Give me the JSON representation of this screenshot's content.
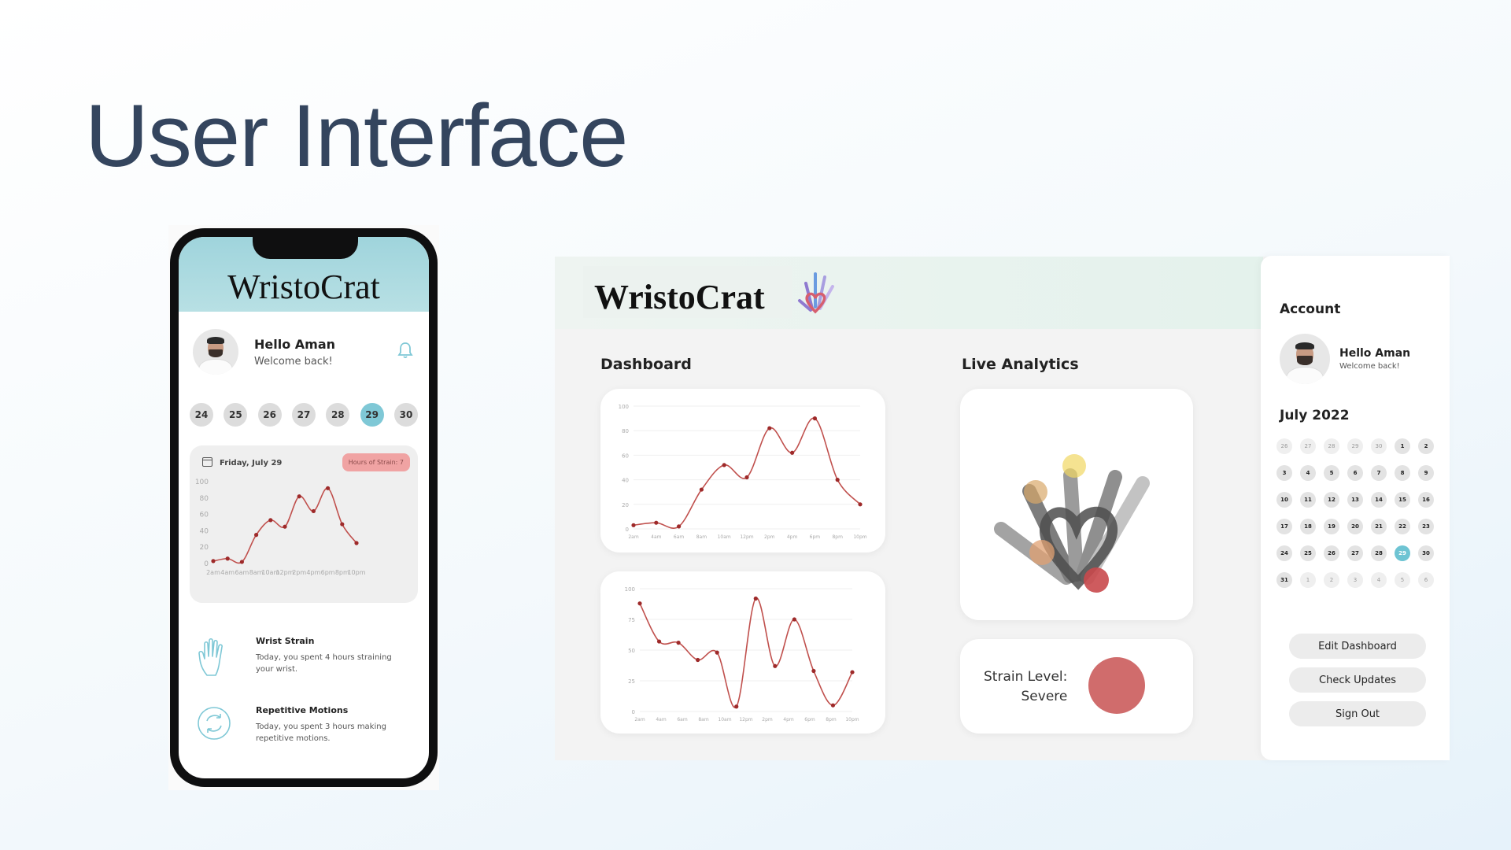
{
  "slide": {
    "title": "User Interface"
  },
  "phone": {
    "brand": "WristoCrat",
    "greeting": "Hello Aman",
    "welcome": "Welcome back!",
    "dates": [
      {
        "day": "24",
        "active": false
      },
      {
        "day": "25",
        "active": false
      },
      {
        "day": "26",
        "active": false
      },
      {
        "day": "27",
        "active": false
      },
      {
        "day": "28",
        "active": false
      },
      {
        "day": "29",
        "active": true
      },
      {
        "day": "30",
        "active": false
      }
    ],
    "card": {
      "date_label": "Friday, July 29",
      "badge": "Hours of Strain: 7"
    },
    "metrics": [
      {
        "title": "Wrist Strain",
        "text": "Today, you spent 4 hours straining your wrist."
      },
      {
        "title": "Repetitive Motions",
        "text": "Today, you spent 3 hours making repetitive motions."
      }
    ]
  },
  "desktop": {
    "brand": "WristoCrat",
    "dashboard_label": "Dashboard",
    "live_label": "Live Analytics",
    "strain_level_label": "Strain Level:",
    "strain_level_value": "Severe",
    "strain_color": "#d06c6c"
  },
  "sidebar": {
    "account_label": "Account",
    "greeting": "Hello Aman",
    "welcome": "Welcome back!",
    "month": "July 2022",
    "calendar": [
      {
        "d": "26",
        "m": true
      },
      {
        "d": "27",
        "m": true
      },
      {
        "d": "28",
        "m": true
      },
      {
        "d": "29",
        "m": true
      },
      {
        "d": "30",
        "m": true
      },
      {
        "d": "1"
      },
      {
        "d": "2"
      },
      {
        "d": "3"
      },
      {
        "d": "4"
      },
      {
        "d": "5"
      },
      {
        "d": "6"
      },
      {
        "d": "7"
      },
      {
        "d": "8"
      },
      {
        "d": "9"
      },
      {
        "d": "10"
      },
      {
        "d": "11"
      },
      {
        "d": "12"
      },
      {
        "d": "13"
      },
      {
        "d": "14"
      },
      {
        "d": "15"
      },
      {
        "d": "16"
      },
      {
        "d": "17"
      },
      {
        "d": "18"
      },
      {
        "d": "19"
      },
      {
        "d": "20"
      },
      {
        "d": "21"
      },
      {
        "d": "22"
      },
      {
        "d": "23"
      },
      {
        "d": "24"
      },
      {
        "d": "25"
      },
      {
        "d": "26"
      },
      {
        "d": "27"
      },
      {
        "d": "28"
      },
      {
        "d": "29",
        "a": true
      },
      {
        "d": "30"
      },
      {
        "d": "31"
      },
      {
        "d": "1",
        "m": true
      },
      {
        "d": "2",
        "m": true
      },
      {
        "d": "3",
        "m": true
      },
      {
        "d": "4",
        "m": true
      },
      {
        "d": "5",
        "m": true
      },
      {
        "d": "6",
        "m": true
      }
    ],
    "buttons": [
      "Edit Dashboard",
      "Check Updates",
      "Sign Out"
    ]
  },
  "chart_data": [
    {
      "type": "line",
      "x": [
        "2am",
        "4am",
        "6am",
        "8am",
        "10am",
        "12pm",
        "2pm",
        "4pm",
        "6pm",
        "8pm",
        "10pm"
      ],
      "series": [
        {
          "values": [
            3,
            6,
            2,
            35,
            53,
            45,
            82,
            64,
            92,
            48,
            25
          ]
        }
      ],
      "ylim": [
        0,
        100
      ],
      "yticks": [
        0,
        20,
        40,
        60,
        80,
        100
      ],
      "color": "#c0504d"
    },
    {
      "type": "line",
      "x": [
        "2am",
        "4am",
        "6am",
        "8am",
        "10am",
        "12pm",
        "2pm",
        "4pm",
        "6pm",
        "8pm",
        "10pm"
      ],
      "series": [
        {
          "values": [
            3,
            5,
            2,
            32,
            52,
            42,
            82,
            62,
            90,
            40,
            20
          ]
        }
      ],
      "ylim": [
        0,
        100
      ],
      "yticks": [
        0,
        20,
        40,
        60,
        80,
        100
      ],
      "color": "#c0504d"
    },
    {
      "type": "line",
      "x": [
        "2am",
        "4am",
        "6am",
        "8am",
        "10am",
        "12pm",
        "2pm",
        "4pm",
        "6pm",
        "8pm",
        "10pm"
      ],
      "series": [
        {
          "values": [
            88,
            57,
            56,
            42,
            48,
            4,
            92,
            37,
            75,
            33,
            5,
            32
          ]
        }
      ],
      "ylim": [
        0,
        100
      ],
      "yticks": [
        0,
        25,
        50,
        75,
        100
      ],
      "color": "#c0504d"
    }
  ]
}
